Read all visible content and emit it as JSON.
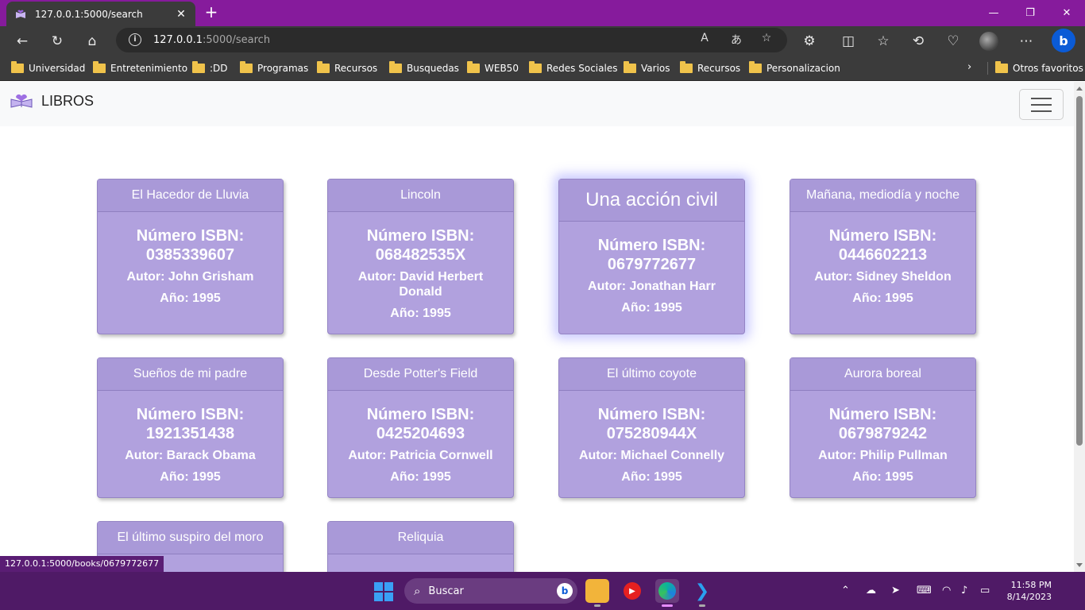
{
  "browser": {
    "tab_title": "127.0.0.1:5000/search",
    "url_host": "127.0.0.1",
    "url_rest": ":5000/search",
    "bookmarks": [
      "Universidad",
      "Entretenimiento",
      ":DD",
      "Programas",
      "Recursos",
      "Busquedas",
      "WEB50",
      "Redes Sociales",
      "Varios",
      "Recursos",
      "Personalizacion"
    ],
    "other_favorites": "Otros favoritos",
    "status_url": "127.0.0.1:5000/books/0679772677"
  },
  "navbar": {
    "brand": "LIBROS"
  },
  "books": [
    {
      "title": "El Hacedor de Lluvia",
      "isbn": "Número ISBN: 0385339607",
      "author": "Autor: John Grisham",
      "year": "Año: 1995"
    },
    {
      "title": "Lincoln",
      "isbn": "Número ISBN: 068482535X",
      "author": "Autor: David Herbert Donald",
      "year": "Año: 1995"
    },
    {
      "title": "Una acción civil",
      "isbn": "Número ISBN: 0679772677",
      "author": "Autor: Jonathan Harr",
      "year": "Año: 1995"
    },
    {
      "title": "Mañana, mediodía y noche",
      "isbn": "Número ISBN: 0446602213",
      "author": "Autor: Sidney Sheldon",
      "year": "Año: 1995"
    },
    {
      "title": "Sueños de mi padre",
      "isbn": "Número ISBN: 1921351438",
      "author": "Autor: Barack Obama",
      "year": "Año: 1995"
    },
    {
      "title": "Desde Potter's Field",
      "isbn": "Número ISBN: 0425204693",
      "author": "Autor: Patricia Cornwell",
      "year": "Año: 1995"
    },
    {
      "title": "El último coyote",
      "isbn": "Número ISBN: 075280944X",
      "author": "Autor: Michael Connelly",
      "year": "Año: 1995"
    },
    {
      "title": "Aurora boreal",
      "isbn": "Número ISBN: 0679879242",
      "author": "Autor: Philip Pullman",
      "year": "Año: 1995"
    },
    {
      "title": "El último suspiro del moro",
      "isbn": "",
      "author": "",
      "year": ""
    },
    {
      "title": "Reliquia",
      "isbn": "",
      "author": "",
      "year": ""
    }
  ],
  "taskbar": {
    "search_placeholder": "Buscar",
    "time": "11:58 PM",
    "date": "8/14/2023"
  },
  "colors": {
    "tabbar": "#861b9c",
    "card": "#b1a1de",
    "taskbar": "#4f1a66"
  }
}
